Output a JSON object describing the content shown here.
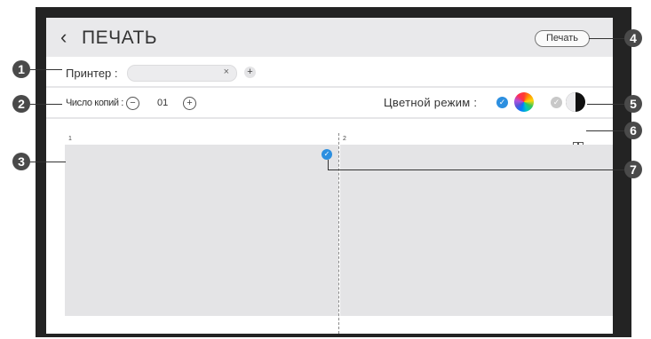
{
  "header": {
    "back_icon": "‹",
    "title": "ПЕЧАТЬ",
    "print_label": "Печать"
  },
  "printer_row": {
    "label": "Принтер :",
    "field_value": "",
    "clear_icon": "×",
    "add_icon": "+"
  },
  "copies_row": {
    "label": "Число копий :",
    "minus_icon": "−",
    "count": "01",
    "plus_icon": "+",
    "color_label": "Цветной режим :",
    "color_mode_selected": "color",
    "accent_color": "#2c8fe0"
  },
  "preview": {
    "pages": [
      {
        "number": "1"
      },
      {
        "number": "2"
      }
    ],
    "selected_check_icon": "✓",
    "layout_icon": "grid-icon"
  },
  "callouts": [
    "1",
    "2",
    "3",
    "4",
    "5",
    "6",
    "7"
  ]
}
